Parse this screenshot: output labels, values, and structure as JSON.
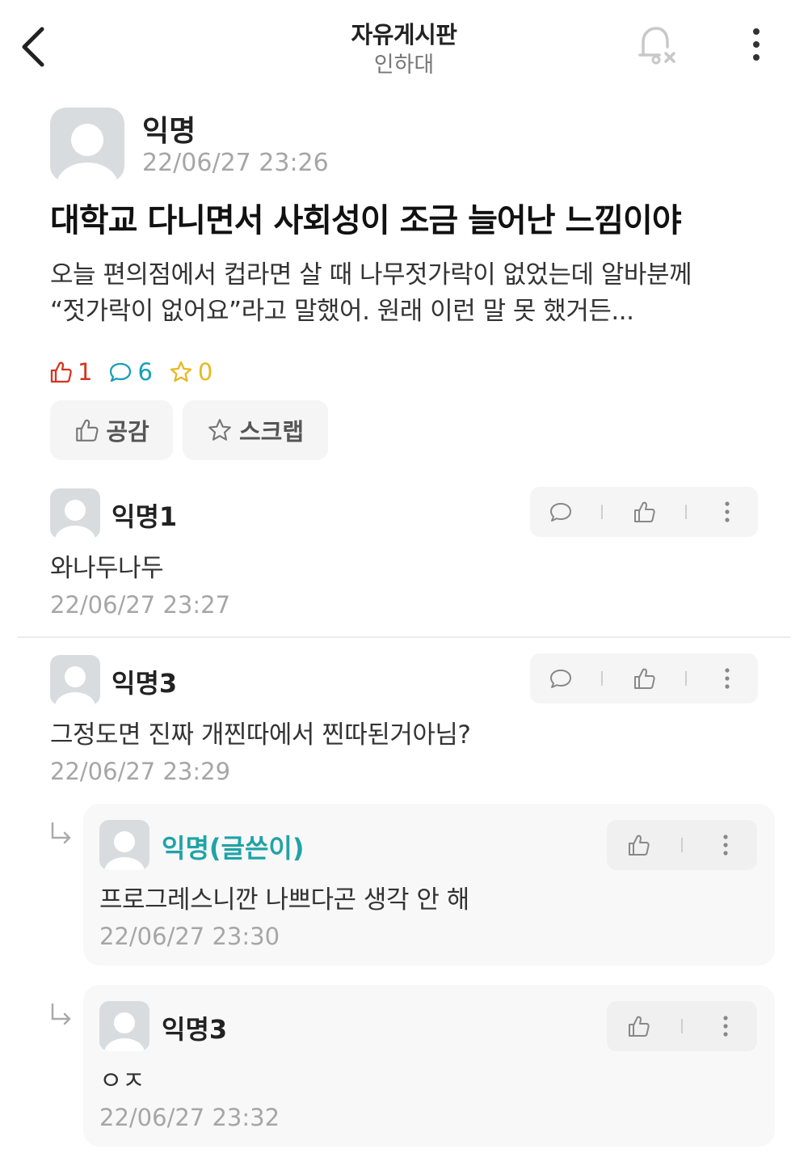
{
  "header": {
    "title": "자유게시판",
    "subtitle": "인하대"
  },
  "post": {
    "author": "익명",
    "time": "22/06/27 23:26",
    "title": "대학교 다니면서 사회성이 조금 늘어난 느낌이야",
    "body_lines": [
      "오늘 편의점에서 컵라면 살 때 나무젓가락이 없었는데 알바분께",
      "“젓가락이 없어요”라고 말했어. 원래 이런 말 못 했거든..."
    ],
    "likes": "1",
    "comments": "6",
    "scraps": "0",
    "like_button": "공감",
    "scrap_button": "스크랩"
  },
  "comments": [
    {
      "author": "익명1",
      "text": "와나두나두",
      "time": "22/06/27 23:27"
    },
    {
      "author": "익명3",
      "text": "그정도면 진짜 개찐따에서 찐따된거아님?",
      "time": "22/06/27 23:29"
    }
  ],
  "replies": [
    {
      "author": "익명(글쓴이)",
      "text": "프로그레스니깐 나쁘다곤 생각 안 해",
      "time": "22/06/27 23:30"
    },
    {
      "author": "익명3",
      "text": "ㅇㅈ",
      "time": "22/06/27 23:32"
    }
  ],
  "colors": {
    "like": "#d6341f",
    "comment": "#15a1b8",
    "scrap": "#e9b820",
    "op_name": "#1fa3a6"
  }
}
